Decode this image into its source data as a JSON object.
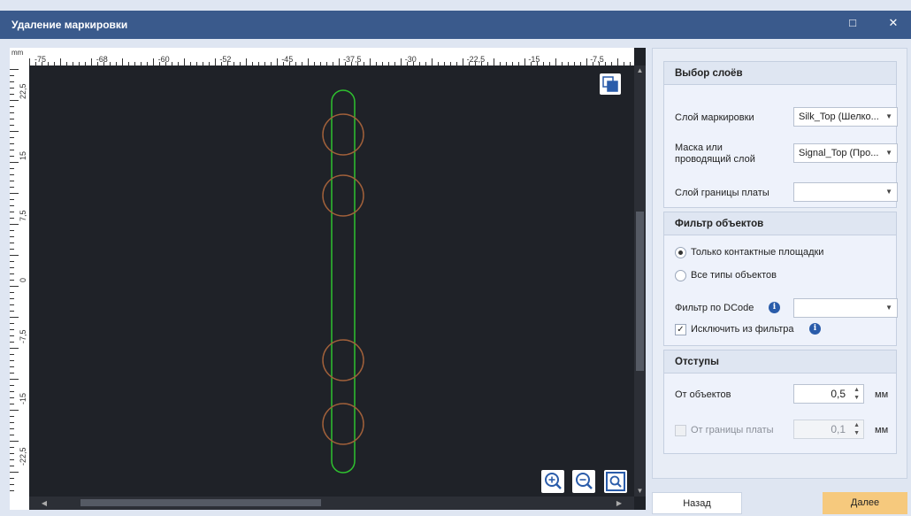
{
  "window": {
    "title": "Удаление маркировки",
    "maximize_symbol": "□",
    "close_symbol": "✕"
  },
  "ruler": {
    "unit": "mm",
    "top_labels": [
      "-75",
      "-68",
      "-60",
      "-52",
      "-45",
      "-37,5",
      "-30",
      "-22,5",
      "-15",
      "-7,5"
    ],
    "left_labels": [
      "22,5",
      "15",
      "7,5",
      "0",
      "-7,5",
      "-15",
      "-22,5"
    ]
  },
  "canvas": {
    "background": "#1f2228",
    "outline_color": "#2fc12f",
    "pad_color": "#a0603a"
  },
  "panel": {
    "layers": {
      "title": "Выбор слоёв",
      "marking_label": "Слой маркировки",
      "marking_value": "Silk_Top (Шелко...",
      "mask_label_1": "Маска или",
      "mask_label_2": "проводящий слой",
      "mask_value": "Signal_Top (Про...",
      "border_label": "Слой границы платы",
      "border_value": ""
    },
    "filter": {
      "title": "Фильтр объектов",
      "option_pads": "Только контактные площадки",
      "option_all": "Все типы объектов",
      "selected": "pads",
      "dcode_label": "Фильтр по DCode",
      "dcode_value": "",
      "exclude_label": "Исключить из фильтра",
      "exclude_checked": true
    },
    "offsets": {
      "title": "Отступы",
      "objects_label": "От объектов",
      "objects_value": "0,5",
      "objects_unit": "мм",
      "border_label": "От границы платы",
      "border_value": "0,1",
      "border_unit": "мм",
      "border_enabled": false
    }
  },
  "footer": {
    "back_label": "Назад",
    "next_label": "Далее",
    "accent": "#f6c97d"
  }
}
